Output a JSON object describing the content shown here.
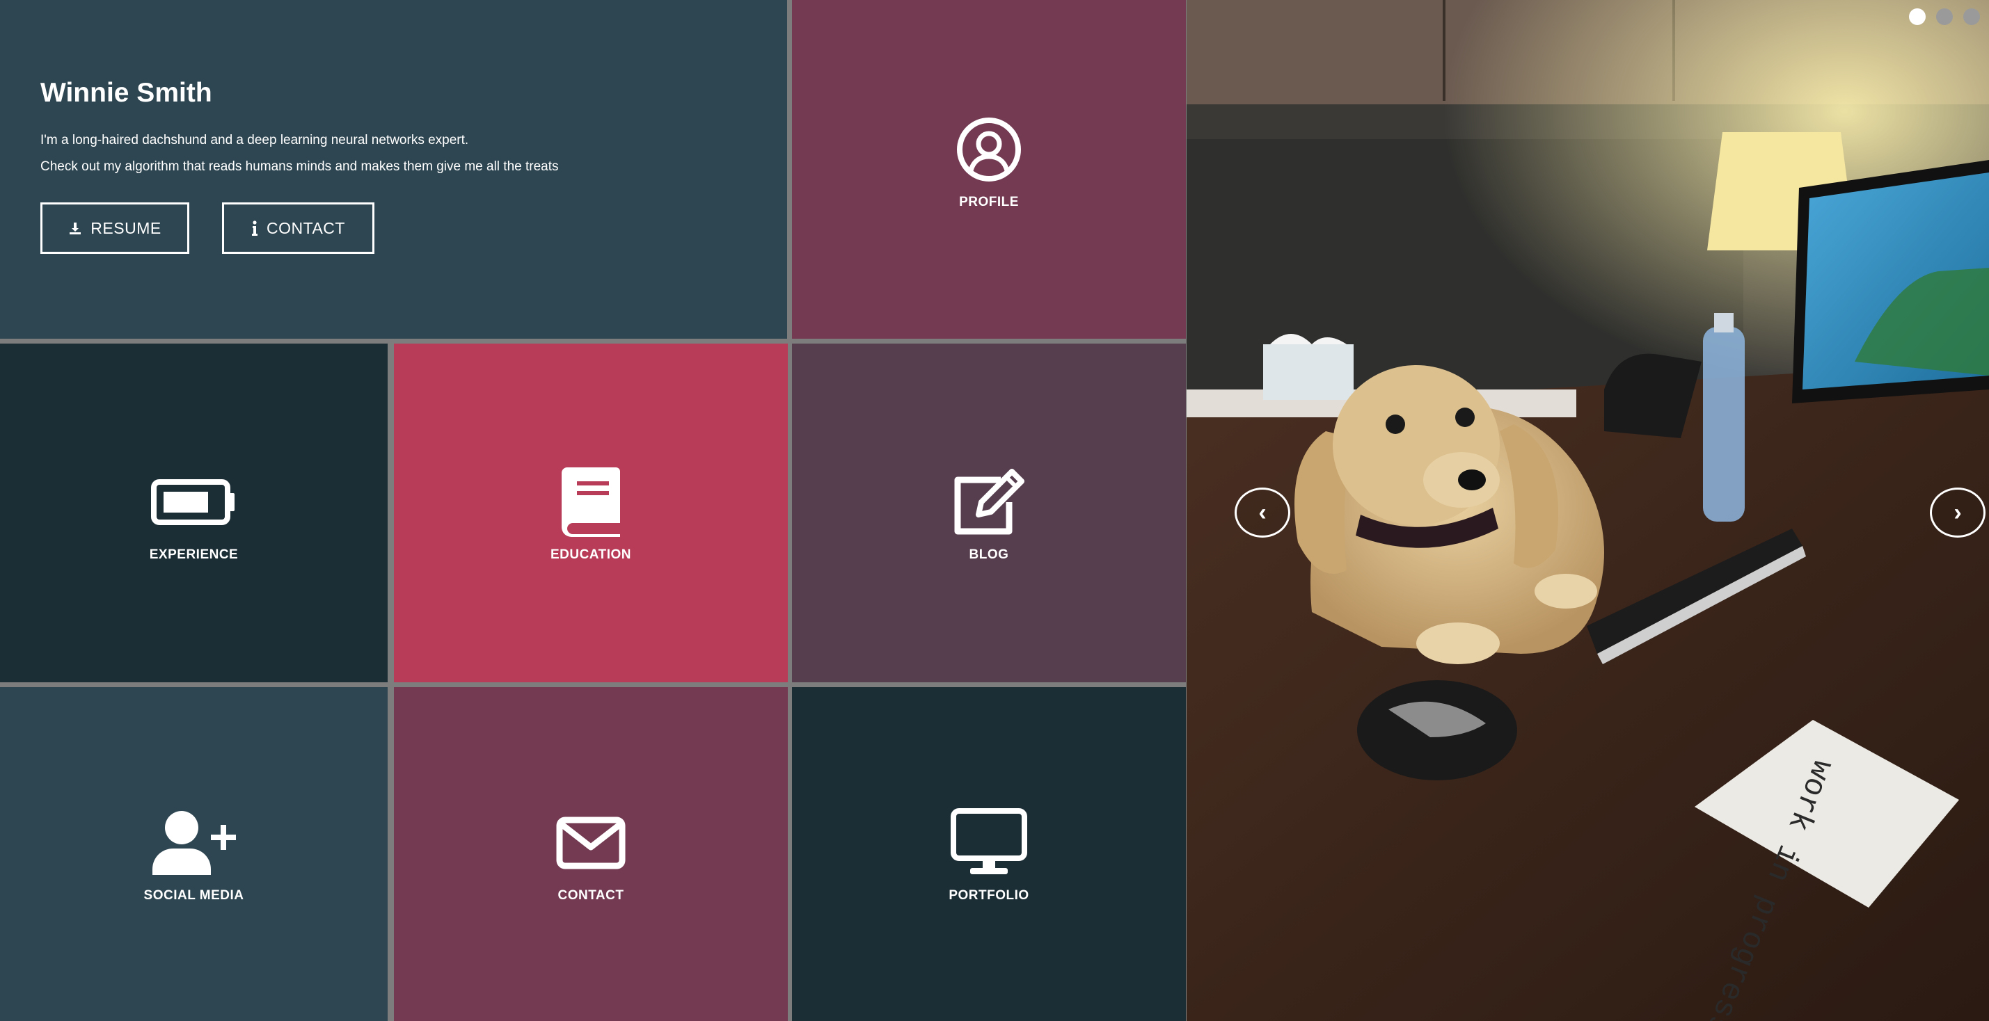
{
  "intro": {
    "name": "Winnie Smith",
    "line1": "I'm a long-haired dachshund and a deep learning neural networks expert.",
    "line2": "Check out my algorithm that reads humans minds and makes them give me all the treats",
    "resume_label": "RESUME",
    "contact_label": "CONTACT"
  },
  "tiles": {
    "profile": "PROFILE",
    "experience": "EXPERIENCE",
    "education": "EDUCATION",
    "blog": "BLOG",
    "social_media": "SOCIAL MEDIA",
    "contact": "CONTACT",
    "portfolio": "PORTFOLIO"
  },
  "icons": {
    "profile": "user-circle-icon",
    "experience": "battery-icon",
    "education": "book-icon",
    "blog": "edit-icon",
    "social_media": "user-plus-icon",
    "contact": "envelope-icon",
    "portfolio": "desktop-icon",
    "resume": "download-icon",
    "contact_button": "info-icon"
  },
  "carousel": {
    "prev_label": "‹",
    "next_label": "›",
    "slide_count": 3,
    "active_slide": 1,
    "notebook_text": "work in progress"
  },
  "colors": {
    "slate": "#2e4651",
    "plum": "#733a52",
    "dark_teal": "#1b2e35",
    "crimson": "#b83c57",
    "mauve": "#573e4f",
    "gap": "#7d7d7d"
  }
}
